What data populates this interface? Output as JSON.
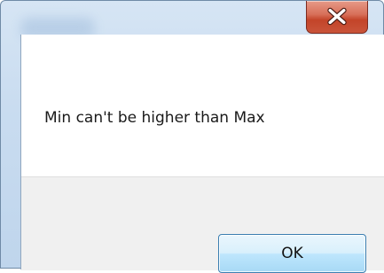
{
  "dialog": {
    "message": "Min can't be higher than Max",
    "ok_label": "OK"
  },
  "titlebar": {
    "close_icon": "close-icon"
  },
  "colors": {
    "close_button": "#c9543a",
    "ok_button_border": "#3c7fb1",
    "footer_background": "#f0f0f0",
    "frame": "#c9dcf0"
  }
}
